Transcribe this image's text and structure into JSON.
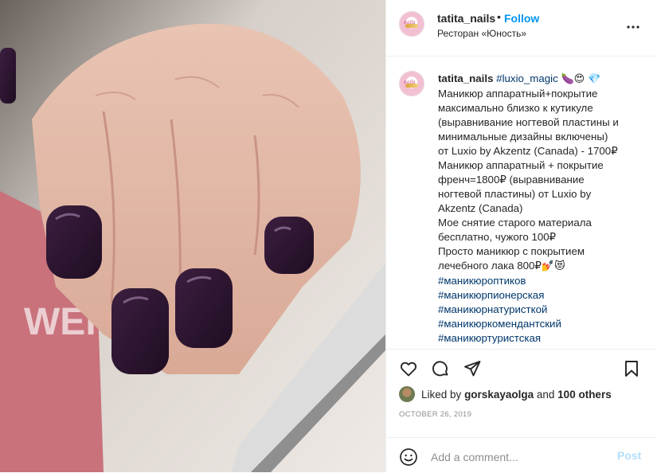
{
  "post": {
    "username": "tatita_nails",
    "dot": "•",
    "follow_label": "Follow",
    "location": "Ресторан «Юность»"
  },
  "caption": {
    "username": "tatita_nails",
    "first_tag": "#luxio_magic",
    "first_emojis": "🍆😍 💎",
    "body": "Маникюр аппаратный+покрытие\nмаксимально близко к кутикуле\n(выравнивание ногтевой пластины и\nминимальные дизайны включены)\nот Luxio by Akzentz (Canada) - 1700₽\nМаникюр аппаратный + покрытие\nфренч=1800₽ (выравнивание\nногтевой пластины) от Luxio by\nAkzentz (Canada)\nМое снятие старого материала\nбесплатно, чужого 100₽\nПросто маникюр с покрытием\nлечебного лака 800₽",
    "body_emojis": "💅😻",
    "hashtags": [
      "#маникюроптиков",
      "#маникюрпионерская",
      "#маникюрнатуристкой",
      "#маникюркомендантский",
      "#маникюртуристская"
    ]
  },
  "likes": {
    "prefix": "Liked by",
    "user": "gorskayaolga",
    "and": "and",
    "others": "100 others"
  },
  "date": "OCTOBER 26, 2019",
  "comment": {
    "placeholder": "Add a comment...",
    "post_label": "Post"
  },
  "icons": {
    "more": "more-horizontal-icon",
    "like": "heart-icon",
    "comment": "comment-bubble-icon",
    "share": "paper-plane-icon",
    "save": "bookmark-icon",
    "emoji": "smile-icon"
  },
  "colors": {
    "follow": "#0095f6",
    "hashtag": "#00376b",
    "post_disabled": "#b2dffc",
    "muted": "#8e8e8e",
    "nail_polish": "#2b1430"
  }
}
